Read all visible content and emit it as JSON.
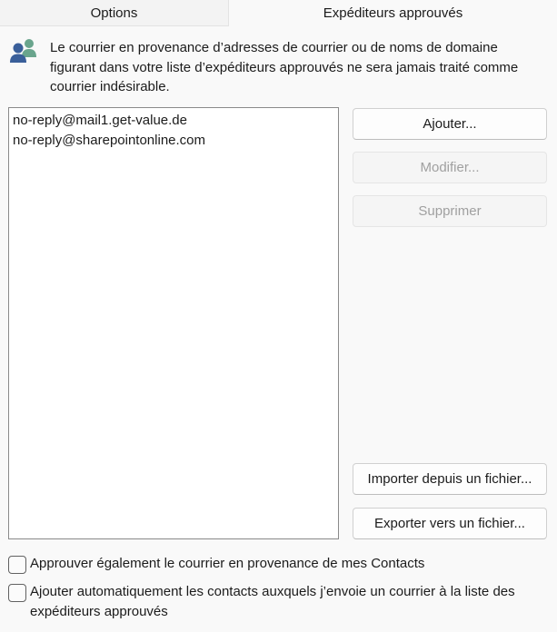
{
  "tabs": [
    {
      "label": "Options",
      "selected": false
    },
    {
      "label": "Expéditeurs approuvés",
      "selected": true
    }
  ],
  "info": {
    "icon": "people-icon",
    "text": "Le courrier en provenance d’adresses de courrier ou de noms de domaine figurant dans votre liste d’expéditeurs approuvés ne sera jamais traité comme courrier indésirable."
  },
  "safe_senders": [
    "no-reply@mail1.get-value.de",
    "no-reply@sharepointonline.com"
  ],
  "buttons": {
    "add": "Ajouter...",
    "modify": "Modifier...",
    "delete": "Supprimer",
    "import": "Importer depuis un fichier...",
    "export": "Exporter vers un fichier..."
  },
  "checkboxes": [
    {
      "label": "Approuver également le courrier en provenance de mes Contacts",
      "checked": false
    },
    {
      "label": "Ajouter automatiquement les contacts auxquels j’envoie un courrier à la liste des expéditeurs approuvés",
      "checked": false
    }
  ],
  "colors": {
    "icon_person_front": "#3a5f9a",
    "icon_person_back": "#6aa58d",
    "disabled_text": "#a0a0a0"
  }
}
